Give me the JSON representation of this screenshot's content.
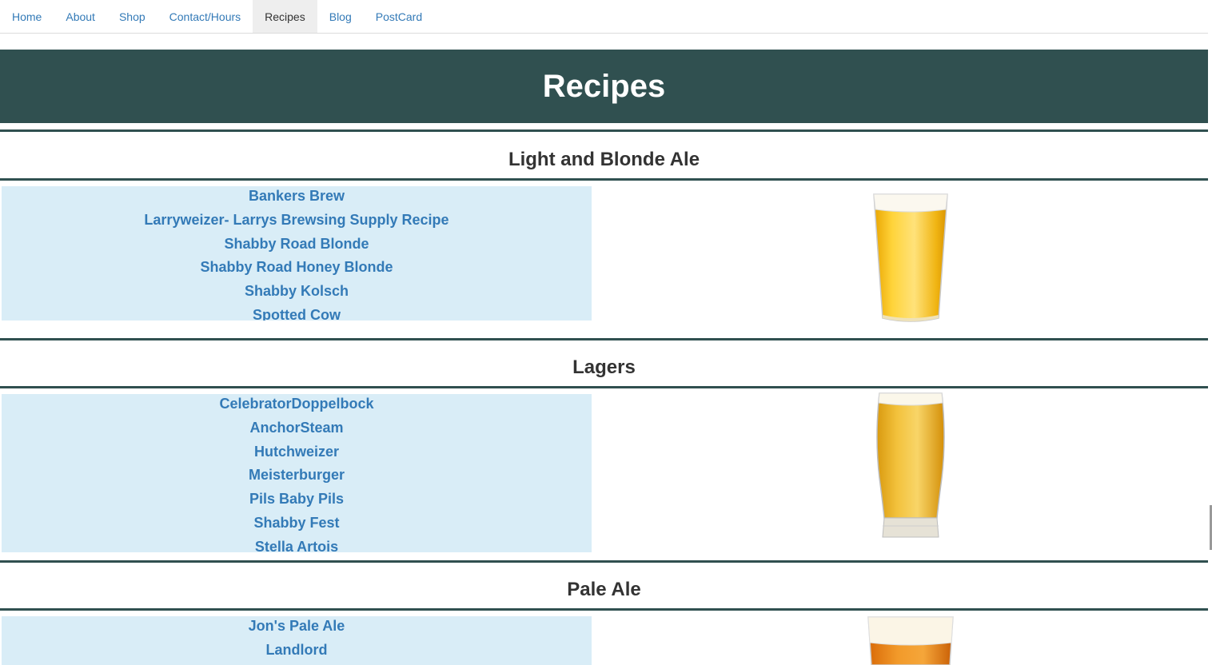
{
  "nav": {
    "items": [
      {
        "label": "Home"
      },
      {
        "label": "About"
      },
      {
        "label": "Shop"
      },
      {
        "label": "Contact/Hours"
      },
      {
        "label": "Recipes"
      },
      {
        "label": "Blog"
      },
      {
        "label": "PostCard"
      }
    ],
    "active": "Recipes"
  },
  "banner": {
    "title": "Recipes"
  },
  "sections": [
    {
      "title": "Light and Blonde Ale",
      "recipes": [
        "Bankers Brew",
        "Larryweizer- Larrys Brewsing Supply Recipe",
        "Shabby Road Blonde",
        "Shabby Road Honey Blonde",
        "Shabby Kolsch",
        "Spotted Cow"
      ],
      "image": "pint-glass-light-beer"
    },
    {
      "title": "Lagers",
      "recipes": [
        "CelebratorDoppelbock",
        "AnchorSteam",
        "Hutchweizer",
        "Meisterburger",
        "Pils Baby Pils",
        "Shabby Fest",
        "Stella Artois"
      ],
      "image": "tulip-pint-lager"
    },
    {
      "title": "Pale Ale",
      "recipes": [
        "Jon's Pale Ale",
        "Landlord"
      ],
      "image": "pint-glass-pale-ale"
    }
  ],
  "colors": {
    "banner_bg": "#305050",
    "list_bg": "#d9edf7",
    "link": "#337ab7",
    "rule": "#305050"
  }
}
